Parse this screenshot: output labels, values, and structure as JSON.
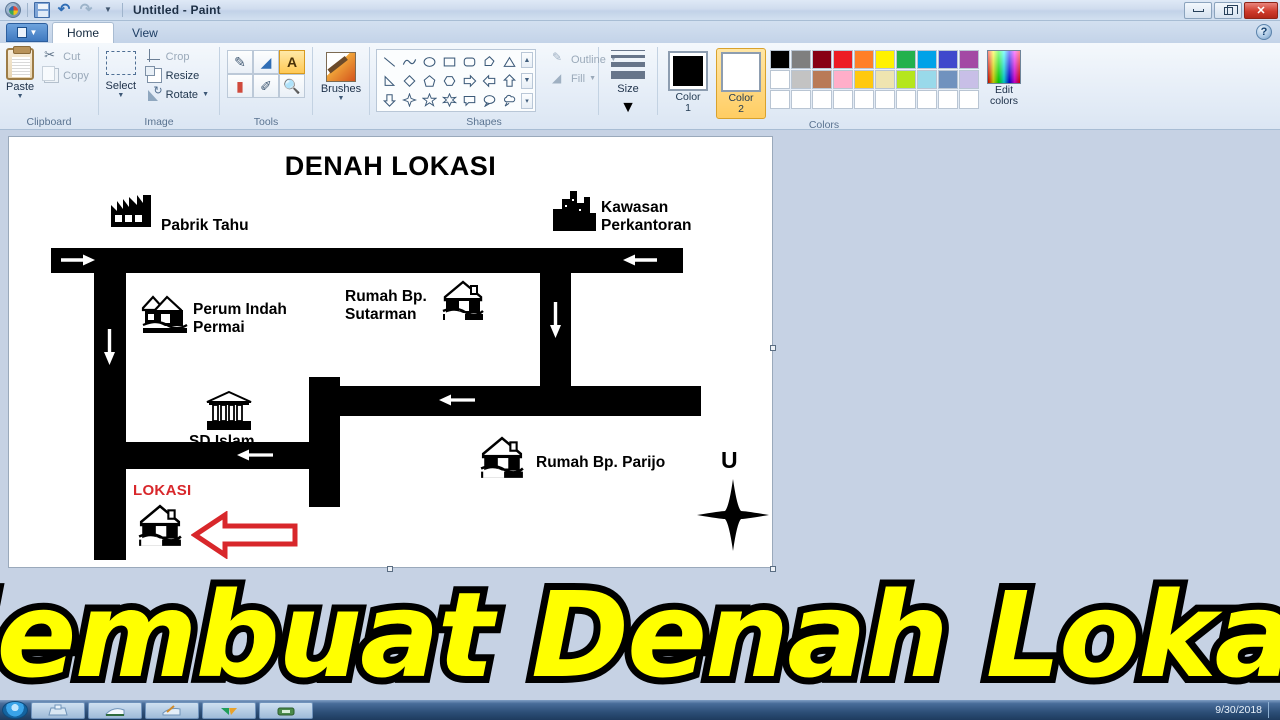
{
  "window": {
    "title": "Untitled - Paint",
    "quick_access": [
      "paint-logo",
      "save-icon",
      "undo-icon",
      "redo-icon",
      "customize-caret"
    ],
    "controls": {
      "minimize": "—",
      "restore": "❐",
      "close": "✕"
    },
    "help": "?"
  },
  "tabs": [
    {
      "label": "Home",
      "active": true
    },
    {
      "label": "View",
      "active": false
    }
  ],
  "ribbon": {
    "groups": [
      {
        "name": "Clipboard",
        "title": "Clipboard",
        "big_button": {
          "label": "Paste",
          "icon": "clipboard-icon"
        },
        "items": [
          {
            "label": "Cut",
            "icon": "scissors-icon",
            "enabled": false
          },
          {
            "label": "Copy",
            "icon": "copy-icon",
            "enabled": false
          }
        ]
      },
      {
        "name": "Image",
        "title": "Image",
        "big_button": {
          "label": "Select",
          "icon": "select-icon"
        },
        "items": [
          {
            "label": "Crop",
            "icon": "crop-icon",
            "enabled": false
          },
          {
            "label": "Resize",
            "icon": "resize-icon",
            "enabled": true
          },
          {
            "label": "Rotate",
            "icon": "rotate-icon",
            "enabled": true
          }
        ]
      },
      {
        "name": "Tools",
        "title": "Tools",
        "tools": [
          {
            "name": "pencil-icon",
            "glyph": "✎",
            "selected": false
          },
          {
            "name": "fill-bucket-icon",
            "glyph": "◢",
            "selected": false
          },
          {
            "name": "text-tool-icon",
            "glyph": "A",
            "selected": true
          },
          {
            "name": "eraser-icon",
            "glyph": "▬",
            "selected": false
          },
          {
            "name": "color-picker-icon",
            "glyph": "✐",
            "selected": false
          },
          {
            "name": "magnifier-icon",
            "glyph": "⚲",
            "selected": false
          }
        ]
      },
      {
        "name": "Brushes",
        "big_button": {
          "label": "Brushes",
          "icon": "brush-icon"
        }
      },
      {
        "name": "Shapes",
        "title": "Shapes",
        "shapes": [
          "line",
          "curve",
          "oval",
          "rectangle",
          "rounded-rectangle",
          "polygon",
          "triangle",
          "right-triangle",
          "diamond",
          "pentagon",
          "hexagon",
          "right-arrow",
          "left-arrow",
          "up-arrow",
          "down-arrow",
          "four-point-star",
          "five-point-star",
          "six-point-star",
          "rounded-callout",
          "oval-callout",
          "cloud-callout"
        ],
        "outline": {
          "label": "Outline",
          "enabled": false
        },
        "fill": {
          "label": "Fill",
          "enabled": false
        }
      },
      {
        "name": "Size",
        "title": "Size",
        "label": "Size"
      },
      {
        "name": "Colors",
        "title": "Colors",
        "color1": {
          "label_line1": "Color",
          "label_line2": "1",
          "value": "#000000"
        },
        "color2": {
          "label_line1": "Color",
          "label_line2": "2",
          "value": "#ffffff"
        },
        "palette_row1": [
          "#000000",
          "#7f7f7f",
          "#880015",
          "#ed1c24",
          "#ff7f27",
          "#fff200",
          "#22b14c",
          "#00a2e8",
          "#3f48cc",
          "#a349a4"
        ],
        "palette_row2": [
          "#ffffff",
          "#c3c3c3",
          "#b97a57",
          "#ffaec9",
          "#ffc90e",
          "#efe4b0",
          "#b5e61d",
          "#99d9ea",
          "#7092be",
          "#c8bfe7"
        ],
        "palette_row3": [
          "#ffffff",
          "#ffffff",
          "#ffffff",
          "#ffffff",
          "#ffffff",
          "#ffffff",
          "#ffffff",
          "#ffffff",
          "#ffffff",
          "#ffffff"
        ],
        "edit_colors": {
          "label_line1": "Edit",
          "label_line2": "colors",
          "icon": "rainbow-icon"
        }
      }
    ]
  },
  "drawing": {
    "title": "DENAH LOKASI",
    "north_marker": "U",
    "labels": [
      {
        "id": "pabrik-tahu",
        "text": "Pabrik Tahu",
        "icon": "factory-icon",
        "color": "#000000"
      },
      {
        "id": "kawasan-perkantoran",
        "text": "Kawasan\nPerkantoran",
        "icon": "city-buildings-icon",
        "color": "#000000"
      },
      {
        "id": "perum-indah-permai",
        "text": "Perum Indah\nPermai",
        "icon": "houses-icon",
        "color": "#000000"
      },
      {
        "id": "rumah-bp-sutarman",
        "text": "Rumah Bp.\nSutarman",
        "icon": "house-icon",
        "color": "#000000"
      },
      {
        "id": "sd-islam",
        "text": "SD Islam",
        "icon": "school-icon",
        "color": "#000000"
      },
      {
        "id": "rumah-bp-parijo",
        "text": "Rumah Bp. Parijo",
        "icon": "house-icon",
        "color": "#000000"
      },
      {
        "id": "lokasi",
        "text": "LOKASI",
        "icon": "house-icon",
        "color": "#d8272b"
      }
    ],
    "direction_arrows": [
      {
        "id": "arrow-top-left",
        "direction": "right"
      },
      {
        "id": "arrow-top-right",
        "direction": "left"
      },
      {
        "id": "arrow-left-down",
        "direction": "down"
      },
      {
        "id": "arrow-right-down",
        "direction": "down"
      },
      {
        "id": "arrow-mid-left",
        "direction": "left"
      },
      {
        "id": "arrow-lower-left",
        "direction": "left"
      }
    ],
    "pointer_arrow": {
      "id": "lokasi-pointer",
      "direction": "left",
      "color": "#d8272b"
    }
  },
  "overlay": {
    "text": "Membuat Denah Lokasi",
    "fill": "#ffff00",
    "stroke": "#000000"
  },
  "taskbar": {
    "start": "start-orb",
    "items": [
      "explorer-icon",
      "media-icon",
      "paint-icon",
      "browser-icon",
      "app-icon"
    ],
    "date": "9/30/2018"
  }
}
